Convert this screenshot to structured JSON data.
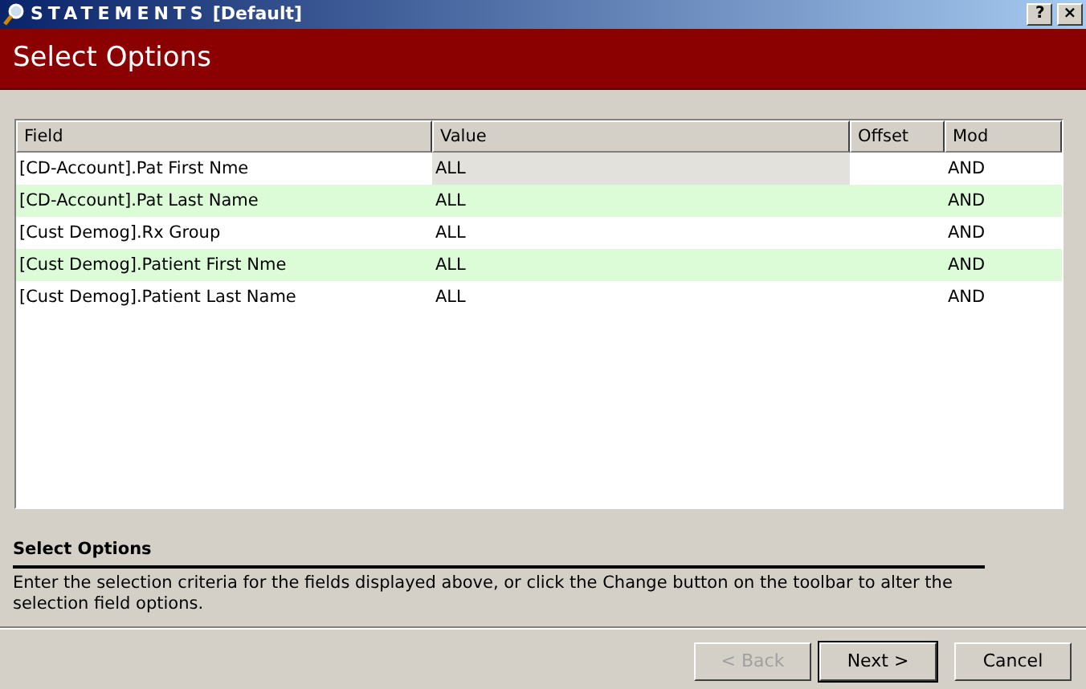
{
  "window": {
    "title": "STATEMENTS",
    "subtitle": "[Default]",
    "buttons": [
      "?",
      "×"
    ]
  },
  "header": {
    "title": "Select Options"
  },
  "table": {
    "columns": [
      "Field",
      "Value",
      "Offset",
      "Mod"
    ],
    "rows": [
      {
        "field": "[CD-Account].Pat First Nme",
        "value": "ALL",
        "offset": "",
        "mod": "AND",
        "value_focused": true
      },
      {
        "field": "[CD-Account].Pat Last Name",
        "value": "ALL",
        "offset": "",
        "mod": "AND",
        "value_focused": false
      },
      {
        "field": "[Cust Demog].Rx Group",
        "value": "ALL",
        "offset": "",
        "mod": "AND",
        "value_focused": false
      },
      {
        "field": "[Cust Demog].Patient First Nme",
        "value": "ALL",
        "offset": "",
        "mod": "AND",
        "value_focused": false
      },
      {
        "field": "[Cust Demog].Patient Last Name",
        "value": "ALL",
        "offset": "",
        "mod": "AND",
        "value_focused": false
      }
    ]
  },
  "help": {
    "title": "Select Options",
    "text": "Enter the selection criteria for the fields displayed above, or click the Change button on the toolbar to alter the selection field options."
  },
  "buttons": [
    {
      "label": "< Back",
      "disabled": true,
      "default": false
    },
    {
      "label": "Next >",
      "disabled": false,
      "default": true
    },
    {
      "label": "Cancel",
      "disabled": false,
      "default": false
    }
  ]
}
